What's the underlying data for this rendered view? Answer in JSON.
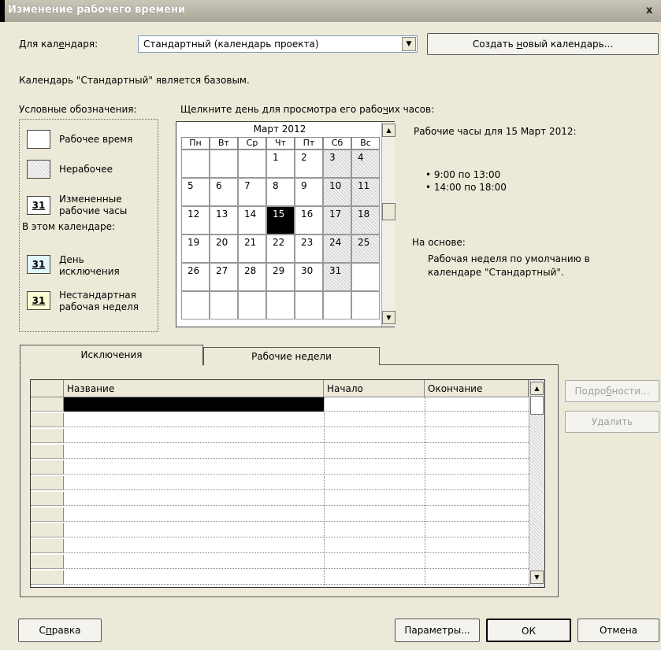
{
  "window": {
    "title": "Изменение рабочего времени",
    "close_glyph": "x"
  },
  "calendar_select": {
    "label_pre": "Для кал",
    "label_ul": "е",
    "label_post": "ндаря:",
    "value": "Стандартный (календарь проекта)",
    "create_pre": "Создать ",
    "create_ul": "н",
    "create_post": "овый календарь..."
  },
  "base_note": "Календарь \"Стандартный\" является базовым.",
  "legend": {
    "title": "Условные обозначения:",
    "working": "Рабочее время",
    "nonworking": "Нерабочее",
    "changed_num": "31",
    "changed_l1": "Измененные",
    "changed_l2": "рабочие часы",
    "in_calendar": "В этом календаре:",
    "exception_num": "31",
    "exception_l1": "День",
    "exception_l2": "исключения",
    "nonstd_num": "31",
    "nonstd_l1": "Нестандартная",
    "nonstd_l2": "рабочая неделя"
  },
  "click_hint_pre": "Щелкните день для просмотра его рабо",
  "click_hint_ul": "ч",
  "click_hint_post": "их часов:",
  "calendar": {
    "month": "Март 2012",
    "weekdays": [
      "Пн",
      "Вт",
      "Ср",
      "Чт",
      "Пт",
      "Сб",
      "Вс"
    ],
    "weeks": [
      [
        "",
        "",
        "",
        "1",
        "2",
        "3",
        "4"
      ],
      [
        "5",
        "6",
        "7",
        "8",
        "9",
        "10",
        "11"
      ],
      [
        "12",
        "13",
        "14",
        "15",
        "16",
        "17",
        "18"
      ],
      [
        "19",
        "20",
        "21",
        "22",
        "23",
        "24",
        "25"
      ],
      [
        "26",
        "27",
        "28",
        "29",
        "30",
        "31",
        ""
      ],
      [
        "",
        "",
        "",
        "",
        "",
        "",
        ""
      ]
    ],
    "selected_day": "15"
  },
  "details": {
    "hours_title": "Рабочие часы для 15 Март 2012:",
    "slot1": "• 9:00 по 13:00",
    "slot2": "• 14:00 по 18:00",
    "based_on": "На основе:",
    "based_l1": "Рабочая неделя по умолчанию в",
    "based_l2": "календаре \"Стандартный\"."
  },
  "tabs": {
    "exceptions": "Исключения",
    "workweeks": "Рабочие недели"
  },
  "table": {
    "col_name": "Название",
    "col_start": "Начало",
    "col_end": "Окончание",
    "row_count": 12
  },
  "side_buttons": {
    "details_pre": "Подро",
    "details_ul": "б",
    "details_post": "ности...",
    "delete": "Удалить"
  },
  "footer": {
    "help_pre": "С",
    "help_ul": "п",
    "help_post": "равка",
    "options": "Параметры...",
    "ok": "ОК",
    "cancel": "Отмена"
  }
}
